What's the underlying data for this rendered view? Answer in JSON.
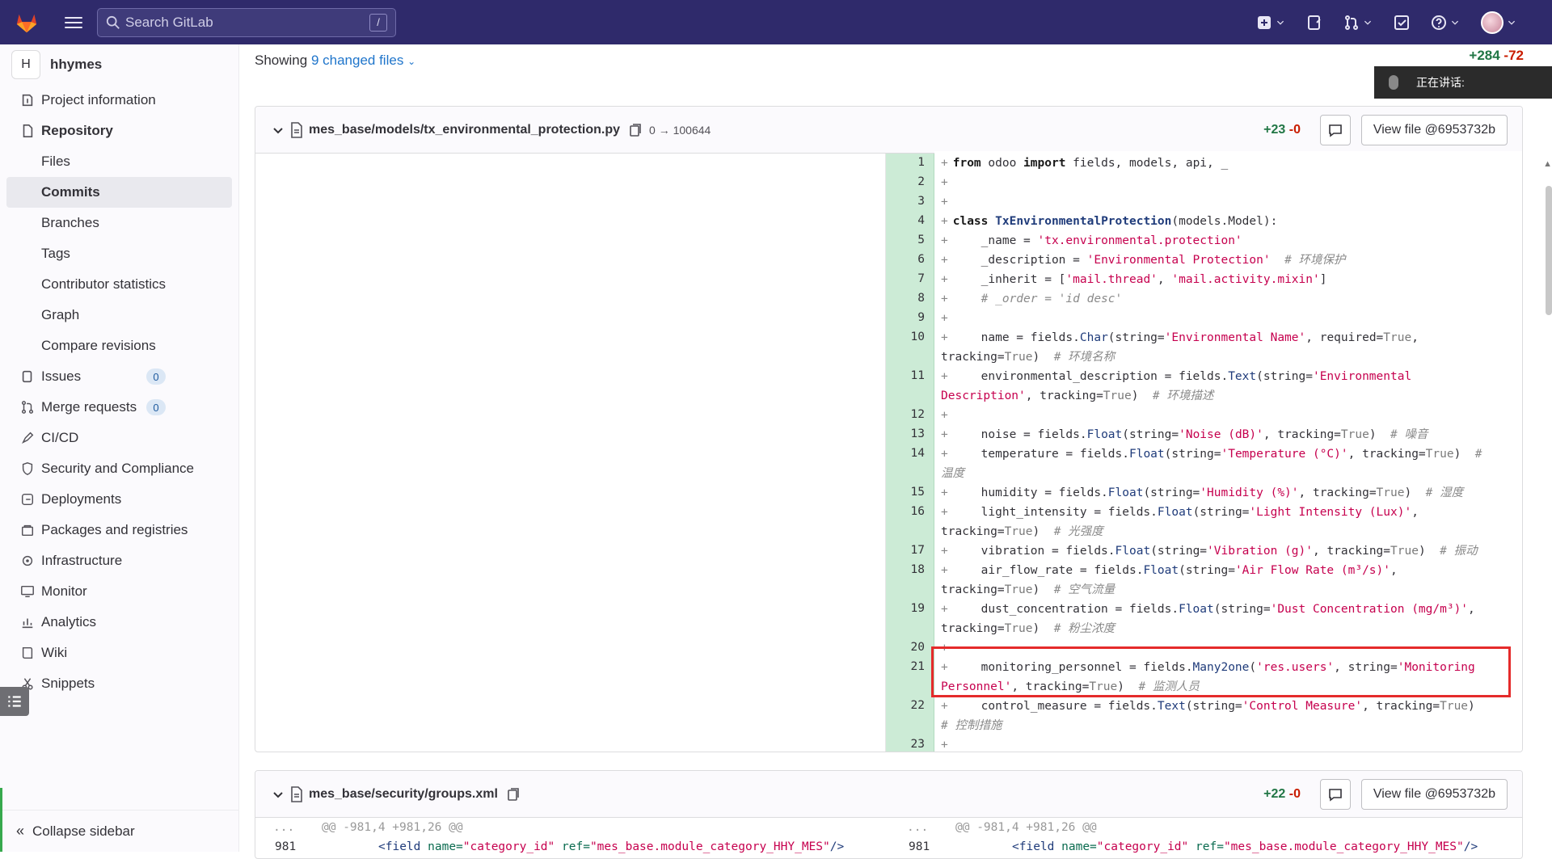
{
  "topbar": {
    "search_placeholder": "Search GitLab",
    "search_shortcut": "/"
  },
  "sidebar": {
    "project_initial": "H",
    "project_name": "hhymes",
    "items": [
      {
        "label": "Project information",
        "icon": "info-icon"
      },
      {
        "label": "Repository",
        "icon": "doc-icon"
      },
      {
        "label": "Issues",
        "icon": "issues-icon",
        "count": "0"
      },
      {
        "label": "Merge requests",
        "icon": "merge-icon",
        "count": "0"
      },
      {
        "label": "CI/CD",
        "icon": "rocket-icon"
      },
      {
        "label": "Security and Compliance",
        "icon": "shield-icon"
      },
      {
        "label": "Deployments",
        "icon": "deploy-icon"
      },
      {
        "label": "Packages and registries",
        "icon": "package-icon"
      },
      {
        "label": "Infrastructure",
        "icon": "cloud-icon"
      },
      {
        "label": "Monitor",
        "icon": "monitor-icon"
      },
      {
        "label": "Analytics",
        "icon": "chart-icon"
      },
      {
        "label": "Wiki",
        "icon": "book-icon"
      },
      {
        "label": "Snippets",
        "icon": "scissors-icon"
      }
    ],
    "repository_sub": [
      "Files",
      "Commits",
      "Branches",
      "Tags",
      "Contributor statistics",
      "Graph",
      "Compare revisions"
    ],
    "collapse_label": "Collapse sidebar"
  },
  "main": {
    "showing_prefix": "Showing",
    "changed_files": "9 changed files",
    "total_plus": "+284",
    "total_minus": "-72",
    "speaking_label": "正在讲话:"
  },
  "file1": {
    "path": "mes_base/models/tx_environmental_protection.py",
    "mode": "0 → 100644",
    "plus": "+23",
    "minus": "-0",
    "view_label": "View file @6953732b"
  },
  "file2": {
    "path": "mes_base/security/groups.xml",
    "plus": "+22",
    "minus": "-0",
    "view_label": "View file @6953732b",
    "hunk_ellipsis": "...",
    "hunk": "@@ -981,4 +981,26 @@",
    "line_no": "981",
    "line_tag_open": "<field",
    "line_attr1": "name=",
    "line_val1": "\"category_id\"",
    "line_attr2": "ref=",
    "line_val2": "\"mes_base.module_category_HHY_MES\"",
    "line_close": "/>"
  }
}
